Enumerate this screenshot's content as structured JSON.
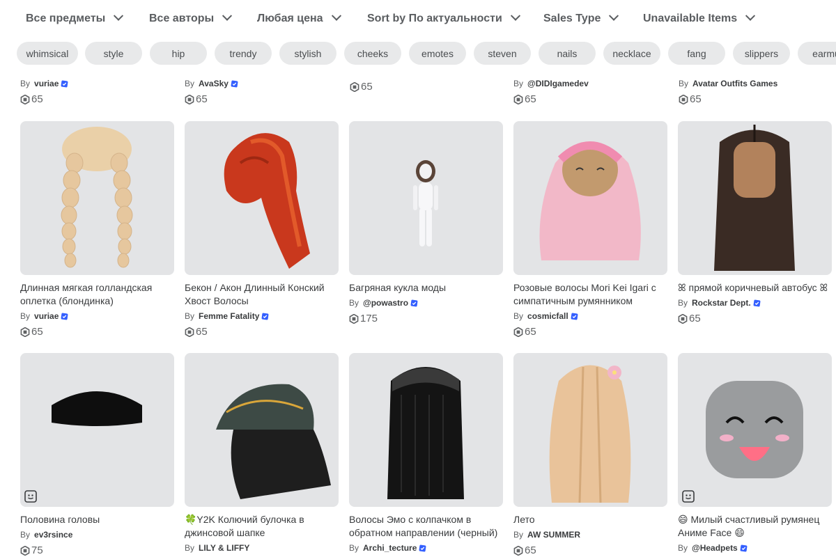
{
  "filters": [
    {
      "label": "Все предметы"
    },
    {
      "label": "Все авторы"
    },
    {
      "label": "Любая цена"
    },
    {
      "label": "Sort by По актуальности"
    },
    {
      "label": "Sales Type"
    },
    {
      "label": "Unavailable Items"
    }
  ],
  "tags": [
    "whimsical",
    "style",
    "hip",
    "trendy",
    "stylish",
    "cheeks",
    "emotes",
    "steven",
    "nails",
    "necklace",
    "fang",
    "slippers",
    "earmu"
  ],
  "top_row": [
    {
      "by": "By",
      "creator": "vuriae",
      "verified": true,
      "price": "65"
    },
    {
      "by": "By",
      "creator": "AvaSky",
      "verified": true,
      "price": "65"
    },
    {
      "price": "65"
    },
    {
      "by": "By",
      "creator": "@DIDIgamedev",
      "verified": false,
      "price": "65"
    },
    {
      "by": "By",
      "creator": "Avatar Outfits Games",
      "verified": false,
      "price": "65"
    }
  ],
  "row2": [
    {
      "title": "Длинная мягкая голландская оплетка (блондинка)",
      "by": "By",
      "creator": "vuriae",
      "verified": true,
      "price": "65",
      "icon": "blonde-braids-hair"
    },
    {
      "title": "Бекон / Акон Длинный Конский Хвост Волосы",
      "by": "By",
      "creator": "Femme Fatality",
      "verified": true,
      "price": "65",
      "icon": "red-ponytail-hair"
    },
    {
      "title": "Багряная кукла моды",
      "by": "By",
      "creator": "@powastro",
      "verified": true,
      "price": "175",
      "icon": "fashion-doll-bundle"
    },
    {
      "title": "Розовые волосы Mori Kei Igari с симпатичным румянником",
      "by": "By",
      "creator": "cosmicfall",
      "verified": true,
      "price": "65",
      "icon": "pink-hair"
    },
    {
      "title": "ꕤ прямой коричневый автобус ꕤ",
      "by": "By",
      "creator": "Rockstar Dept.",
      "verified": true,
      "price": "65",
      "icon": "straight-brown-hair"
    }
  ],
  "row3": [
    {
      "title": "Половина головы",
      "by": "By",
      "creator": "ev3rsince",
      "verified": false,
      "price": "75",
      "icon": "half-head"
    },
    {
      "title": "🍀Y2K Колючий булочка в джинсовой шапке",
      "by": "By",
      "creator": "LILY & LIFFY",
      "verified": false,
      "price": "",
      "icon": "denim-cap-hair"
    },
    {
      "title": "Волосы Эмо с колпачком в обратном направлении (черный)",
      "by": "By",
      "creator": "Archi_tecture",
      "verified": true,
      "price": "",
      "icon": "emo-black-hair"
    },
    {
      "title": "Лето",
      "by": "By",
      "creator": "AW SUMMER",
      "verified": false,
      "price": "65",
      "icon": "summer-blonde-hair"
    },
    {
      "title": "😄 Милый счастливый румянец Аниме Face 😄",
      "by": "By",
      "creator": "@Headpets",
      "verified": true,
      "price": "",
      "icon": "anime-face"
    }
  ],
  "colors": {
    "accent": "#335fff",
    "tag_bg": "#e8e9ea",
    "thumb_bg": "#e3e4e6"
  }
}
